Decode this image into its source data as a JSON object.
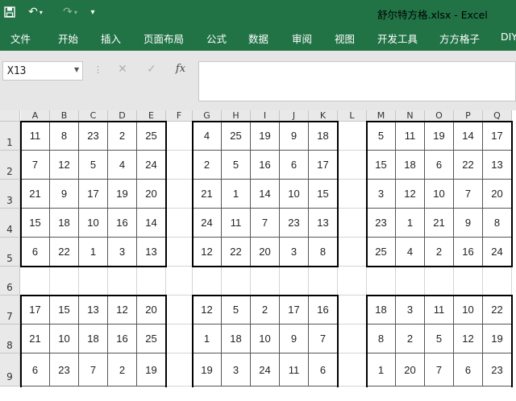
{
  "titlebar": {
    "title": "舒尔特方格.xlsx - Excel"
  },
  "icons": {
    "save": "save-icon",
    "undo": "undo-icon",
    "redo": "redo-icon",
    "customize": "customize-qat-icon"
  },
  "ribbon": {
    "tabs": [
      "文件",
      "开始",
      "插入",
      "页面布局",
      "公式",
      "数据",
      "审阅",
      "视图",
      "开发工具",
      "方方格子",
      "DIY"
    ]
  },
  "formula_bar": {
    "name_box": "X13",
    "cancel": "✕",
    "enter": "✓",
    "fx": "fx",
    "content": ""
  },
  "sheet": {
    "columns": [
      "A",
      "B",
      "C",
      "D",
      "E",
      "F",
      "G",
      "H",
      "I",
      "J",
      "K",
      "L",
      "M",
      "N",
      "O",
      "P",
      "Q"
    ],
    "rows": [
      "1",
      "2",
      "3",
      "4",
      "5",
      "6",
      "7",
      "8",
      "9"
    ],
    "cells": [
      [
        "11",
        "8",
        "23",
        "2",
        "25",
        "",
        "4",
        "25",
        "19",
        "9",
        "18",
        "",
        "5",
        "11",
        "19",
        "14",
        "17"
      ],
      [
        "7",
        "12",
        "5",
        "4",
        "24",
        "",
        "2",
        "5",
        "16",
        "6",
        "17",
        "",
        "15",
        "18",
        "6",
        "22",
        "13"
      ],
      [
        "21",
        "9",
        "17",
        "19",
        "20",
        "",
        "21",
        "1",
        "14",
        "10",
        "15",
        "",
        "3",
        "12",
        "10",
        "7",
        "20"
      ],
      [
        "15",
        "18",
        "10",
        "16",
        "14",
        "",
        "24",
        "11",
        "7",
        "23",
        "13",
        "",
        "23",
        "1",
        "21",
        "9",
        "8"
      ],
      [
        "6",
        "22",
        "1",
        "3",
        "13",
        "",
        "12",
        "22",
        "20",
        "3",
        "8",
        "",
        "25",
        "4",
        "2",
        "16",
        "24"
      ],
      [
        "",
        "",
        "",
        "",
        "",
        "",
        "",
        "",
        "",
        "",
        "",
        "",
        "",
        "",
        "",
        "",
        ""
      ],
      [
        "17",
        "15",
        "13",
        "12",
        "20",
        "",
        "12",
        "5",
        "2",
        "17",
        "16",
        "",
        "18",
        "3",
        "11",
        "10",
        "22"
      ],
      [
        "21",
        "10",
        "18",
        "16",
        "25",
        "",
        "1",
        "18",
        "10",
        "9",
        "7",
        "",
        "8",
        "2",
        "5",
        "12",
        "19"
      ],
      [
        "6",
        "23",
        "7",
        "2",
        "19",
        "",
        "19",
        "3",
        "24",
        "11",
        "6",
        "",
        "1",
        "20",
        "7",
        "6",
        "23"
      ]
    ]
  }
}
